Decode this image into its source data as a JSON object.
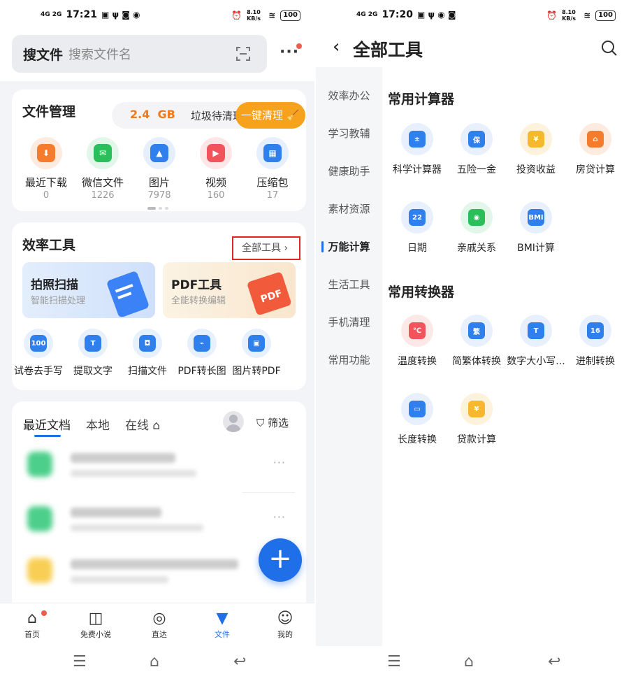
{
  "left": {
    "status": {
      "network": "4G 2G",
      "time": "17:21",
      "right": "8.10 KB/s",
      "battery": "100"
    },
    "search": {
      "keyword": "搜文件",
      "placeholder": "搜索文件名"
    },
    "file_mgmt": {
      "title": "文件管理",
      "junk_size": "2.4",
      "junk_unit": "GB",
      "junk_text": "垃圾待清理",
      "clean_button": "一键清理",
      "items": [
        {
          "label": "最近下载",
          "count": "0",
          "icon": "download-icon",
          "color": "#f57c2c"
        },
        {
          "label": "微信文件",
          "count": "1226",
          "icon": "wechat-icon",
          "color": "#2bbf5b"
        },
        {
          "label": "图片",
          "count": "7978",
          "icon": "image-icon",
          "color": "#2f80ed"
        },
        {
          "label": "视频",
          "count": "160",
          "icon": "video-icon",
          "color": "#f2545b"
        },
        {
          "label": "压缩包",
          "count": "17",
          "icon": "zip-icon",
          "color": "#2f80ed"
        }
      ]
    },
    "efficiency": {
      "title": "效率工具",
      "all_tools": "全部工具",
      "tile1": {
        "title": "拍照扫描",
        "subtitle": "智能扫描处理"
      },
      "tile2": {
        "title": "PDF工具",
        "subtitle": "全能转换编辑"
      },
      "tools": [
        {
          "label": "试卷去手写",
          "icon": "exam-icon"
        },
        {
          "label": "提取文字",
          "icon": "text-extract-icon"
        },
        {
          "label": "扫描文件",
          "icon": "scan-file-icon"
        },
        {
          "label": "PDF转长图",
          "icon": "pdf-long-image-icon"
        },
        {
          "label": "图片转PDF",
          "icon": "image-to-pdf-icon"
        }
      ]
    },
    "docs": {
      "tabs": [
        "最近文档",
        "本地",
        "在线"
      ],
      "filter": "筛选"
    },
    "nav": [
      {
        "label": "首页",
        "glyph": "⌂"
      },
      {
        "label": "免费小说",
        "glyph": "📖"
      },
      {
        "label": "直达",
        "glyph": "◎"
      },
      {
        "label": "文件",
        "glyph": "▼"
      },
      {
        "label": "我的",
        "glyph": "☺"
      }
    ]
  },
  "right": {
    "status": {
      "network": "4G 2G",
      "time": "17:20",
      "right": "8.10 KB/s",
      "battery": "100"
    },
    "title": "全部工具",
    "sidebar": [
      "效率办公",
      "学习教辅",
      "健康助手",
      "素材资源",
      "万能计算",
      "生活工具",
      "手机清理",
      "常用功能"
    ],
    "active_sidebar": "万能计算",
    "calc_section": {
      "title": "常用计算器",
      "items": [
        {
          "label": "科学计算器",
          "glyph": "±",
          "bg": "#e8f0fd",
          "fg": "#2f80ed"
        },
        {
          "label": "五险一金",
          "glyph": "保",
          "bg": "#e8f0fd",
          "fg": "#2f80ed"
        },
        {
          "label": "投资收益",
          "glyph": "¥",
          "bg": "#fdf3dc",
          "fg": "#f5b82e"
        },
        {
          "label": "房贷计算",
          "glyph": "⌂",
          "bg": "#fdebe0",
          "fg": "#f57c2c"
        },
        {
          "label": "日期",
          "glyph": "22",
          "bg": "#e8f0fd",
          "fg": "#2f80ed"
        },
        {
          "label": "亲戚关系",
          "glyph": "◉",
          "bg": "#e3f6ea",
          "fg": "#2bbf5b"
        },
        {
          "label": "BMI计算",
          "glyph": "BMI",
          "bg": "#e8f0fd",
          "fg": "#2f80ed"
        }
      ]
    },
    "convert_section": {
      "title": "常用转换器",
      "items": [
        {
          "label": "温度转换",
          "glyph": "℃",
          "bg": "#fde8e8",
          "fg": "#f2545b"
        },
        {
          "label": "简繁体转换",
          "glyph": "繁",
          "bg": "#e8f0fd",
          "fg": "#2f80ed"
        },
        {
          "label": "数字大小写...",
          "glyph": "T",
          "bg": "#e8f0fd",
          "fg": "#2f80ed"
        },
        {
          "label": "进制转换",
          "glyph": "16",
          "bg": "#e8f0fd",
          "fg": "#2f80ed"
        },
        {
          "label": "长度转换",
          "glyph": "▭",
          "bg": "#e8f0fd",
          "fg": "#2f80ed"
        },
        {
          "label": "贷款计算",
          "glyph": "¥",
          "bg": "#fdf3dc",
          "fg": "#f5b82e"
        }
      ]
    }
  }
}
